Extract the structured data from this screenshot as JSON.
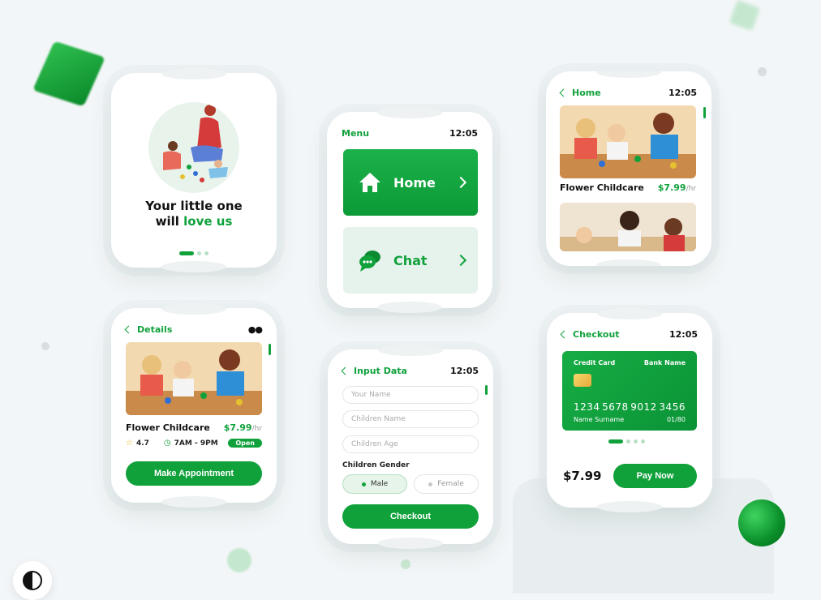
{
  "colors": {
    "accent": "#10a13b",
    "background": "#f3f6f8"
  },
  "onboarding": {
    "title_line1": "Your little one",
    "title_prefix": "will ",
    "title_highlight": "love us"
  },
  "menu": {
    "header": "Menu",
    "time": "12:05",
    "items": [
      {
        "label": "Home",
        "icon": "home-icon"
      },
      {
        "label": "Chat",
        "icon": "chat-icon"
      }
    ]
  },
  "home_list": {
    "back_label": "Home",
    "time": "12:05",
    "card": {
      "name": "Flower Childcare",
      "price": "$7.99",
      "per": "/hr"
    }
  },
  "details": {
    "back_label": "Details",
    "name": "Flower Childcare",
    "price": "$7.99",
    "per": "/hr",
    "rating": "4.7",
    "hours": "7AM - 9PM",
    "status": "Open",
    "cta": "Make Appointment"
  },
  "input_data": {
    "back_label": "Input Data",
    "time": "12:05",
    "fields": {
      "name_placeholder": "Your Name",
      "children_name_placeholder": "Children Name",
      "children_age_placeholder": "Children Age"
    },
    "gender_label": "Children Gender",
    "options": {
      "male": "Male",
      "female": "Female"
    },
    "cta": "Checkout"
  },
  "checkout": {
    "back_label": "Checkout",
    "time": "12:05",
    "card": {
      "type": "Credit Card",
      "bank": "Bank Name",
      "num1": "1234",
      "num2": "5678",
      "num3": "9012",
      "num4": "3456",
      "holder": "Name Surname",
      "expiry": "01/80"
    },
    "total": "$7.99",
    "cta": "Pay Now"
  }
}
